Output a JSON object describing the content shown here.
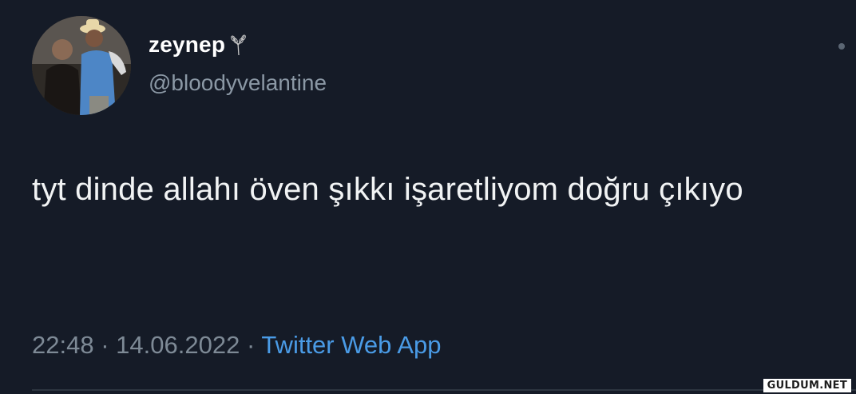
{
  "tweet": {
    "display_name": "zeynep",
    "handle": "@bloodyvelantine",
    "text": "tyt dinde allahı öven şıkkı işaretliyom doğru çıkıyo",
    "time": "22:48",
    "separator": "·",
    "date": "14.06.2022",
    "source": "Twitter Web App"
  },
  "icons": {
    "name_emoji": "wheat-sheaf-icon",
    "more": "more-options-icon"
  },
  "watermark": "GULDUM.NET",
  "colors": {
    "background": "#151b27",
    "link": "#4a9be6",
    "secondary_text": "#8b98a5"
  }
}
